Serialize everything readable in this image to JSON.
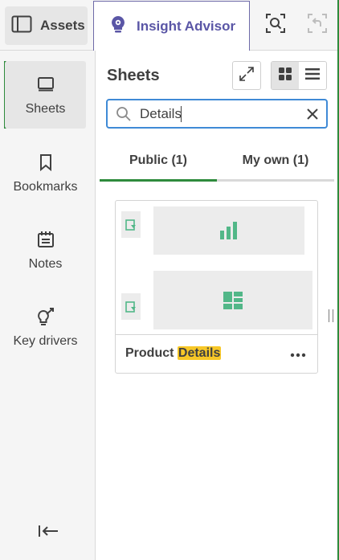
{
  "topbar": {
    "assets_label": "Assets",
    "insight_label": "Insight Advisor",
    "insight_color": "#5a56a6",
    "icons": [
      "panel-icon",
      "bulb-icon",
      "smart-search-icon",
      "undo-selection-icon"
    ]
  },
  "rail": {
    "items": [
      {
        "label": "Sheets",
        "icon": "sheet-icon",
        "active": true
      },
      {
        "label": "Bookmarks",
        "icon": "bookmark-icon",
        "active": false
      },
      {
        "label": "Notes",
        "icon": "notes-icon",
        "active": false
      },
      {
        "label": "Key drivers",
        "icon": "key-drivers-icon",
        "active": false
      }
    ],
    "accent_color": "#2e8b3c"
  },
  "panel": {
    "title": "Sheets",
    "search": {
      "value": "Details"
    },
    "tabs": [
      {
        "label": "Public (1)",
        "active": true
      },
      {
        "label": "My own (1)",
        "active": false
      }
    ],
    "sheet_card": {
      "title_prefix": "Product ",
      "title_highlight": "Details",
      "highlight_color": "#f7c727"
    }
  },
  "colors": {
    "accent_green": "#2e8b3c",
    "focus_blue": "#3f8ad6",
    "thumb_icon_green": "#52b788"
  }
}
